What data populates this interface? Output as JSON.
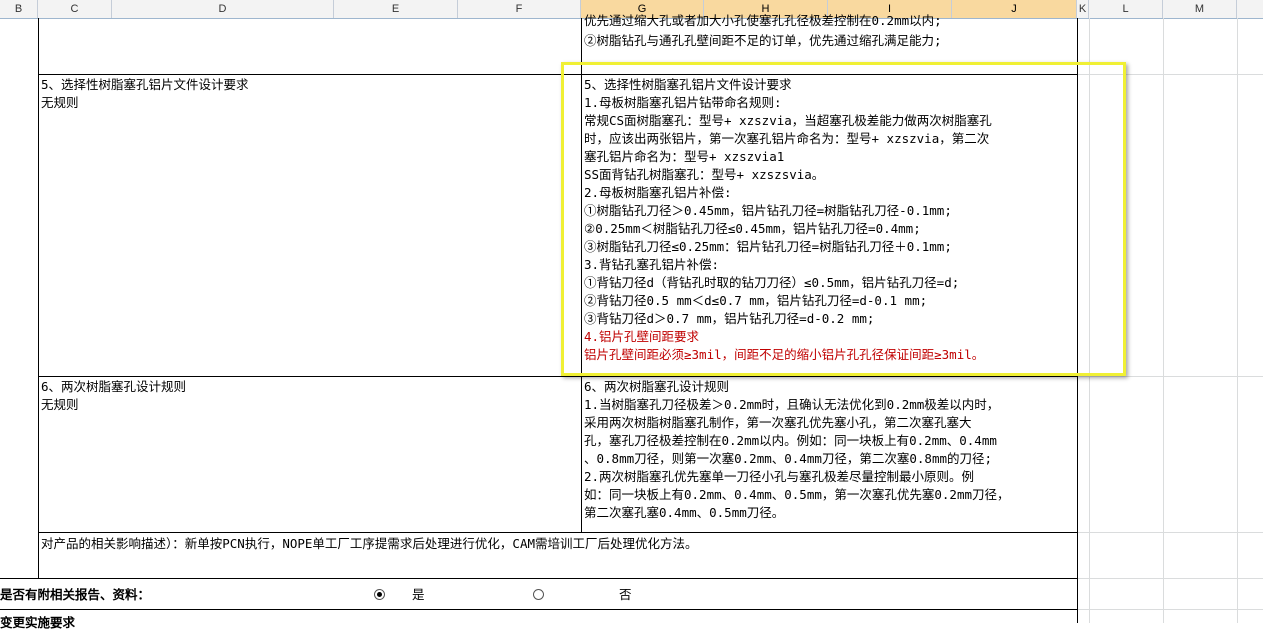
{
  "columns": [
    "B",
    "C",
    "D",
    "E",
    "F",
    "G",
    "H",
    "I",
    "J",
    "K",
    "L",
    "M"
  ],
  "top_text": {
    "line1": "优先通过缩大孔或者加大小孔使塞孔孔径极差控制在0.2mm以内;",
    "line2": "②树脂钻孔与通孔孔壁间距不足的订单，优先通过缩孔满足能力;"
  },
  "row5": {
    "left_title": "5、选择性树脂塞孔铝片文件设计要求",
    "left_value": "无规则",
    "right_lines": [
      "5、选择性树脂塞孔铝片文件设计要求",
      "1.母板树脂塞孔铝片钻带命名规则:",
      "常规CS面树脂塞孔：型号+ xzszvia，当超塞孔极差能力做两次树脂塞孔",
      "时，应该出两张铝片，第一次塞孔铝片命名为：型号+ xzszvia，第二次",
      "塞孔铝片命名为：型号+ xzszvia1",
      "SS面背钻孔树脂塞孔：型号+ xzszsvia。",
      "2.母板树脂塞孔铝片补偿:",
      "①树脂钻孔刀径＞0.45mm，铝片钻孔刀径=树脂钻孔刀径-0.1mm;",
      "②0.25mm＜树脂钻孔刀径≤0.45mm，铝片钻孔刀径=0.4mm;",
      "③树脂钻孔刀径≤0.25mm：铝片钻孔刀径=树脂钻孔刀径＋0.1mm;",
      "3.背钻孔塞孔铝片补偿:",
      "①背钻刀径d（背钻孔时取的钻刀刀径）≤0.5mm，铝片钻孔刀径=d;",
      "②背钻刀径0.5 mm＜d≤0.7 mm，铝片钻孔刀径=d-0.1 mm;",
      "③背钻刀径d＞0.7 mm，铝片钻孔刀径=d-0.2 mm;"
    ],
    "red_lines": [
      "4.铝片孔壁间距要求",
      "铝片孔壁间距必须≥3mil，间距不足的缩小铝片孔孔径保证间距≥3mil。"
    ]
  },
  "row6": {
    "left_title": "6、两次树脂塞孔设计规则",
    "left_value": "无规则",
    "right_lines": [
      "6、两次树脂塞孔设计规则",
      "1.当树脂塞孔刀径极差＞0.2mm时，且确认无法优化到0.2mm极差以内时，",
      "采用两次树脂树脂塞孔制作，第一次塞孔优先塞小孔，第二次塞孔塞大",
      "孔，塞孔刀径极差控制在0.2mm以内。例如：同一块板上有0.2mm、0.4mm",
      "、0.8mm刀径，则第一次塞0.2mm、0.4mm刀径，第二次塞0.8mm的刀径;",
      "2.两次树脂塞孔优先塞单一刀径小孔与塞孔极差尽量控制最小原则。例",
      "如：同一块板上有0.2mm、0.4mm、0.5mm，第一次塞孔优先塞0.2mm刀径，",
      "第二次塞孔塞0.4mm、0.5mm刀径。"
    ]
  },
  "impact_text": "对产品的相关影响描述）：新单按PCN执行，NOPE单工厂工序提需求后处理进行优化，CAM需培训工厂后处理优化方法。",
  "attach": {
    "label": "是否有附相关报告、资料：",
    "yes": "是",
    "no": "否",
    "selected": "yes"
  },
  "bottom_cut_text": "变更实施要求"
}
